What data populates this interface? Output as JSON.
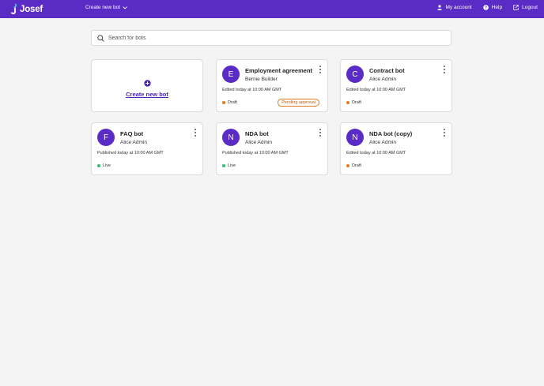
{
  "header": {
    "brand": "Josef",
    "create_menu_label": "Create new bot",
    "nav": {
      "account": "My account",
      "help": "Help",
      "logout": "Logout"
    }
  },
  "search": {
    "placeholder": "Search for bots",
    "value": ""
  },
  "new_bot_card": {
    "label": "Create new bot"
  },
  "bots": [
    {
      "initial": "E",
      "name": "Employment agreement",
      "owner": "Bernie Builder",
      "meta": "Edited today at 10:00 AM GMT",
      "status": "Draft",
      "badge": "Pending approval"
    },
    {
      "initial": "C",
      "name": "Contract bot",
      "owner": "Alice Admin",
      "meta": "Edited today at 10:00 AM GMT",
      "status": "Draft"
    },
    {
      "initial": "F",
      "name": "FAQ bot",
      "owner": "Alice Admin",
      "meta": "Published today at 10:00 AM GMT",
      "status": "Live"
    },
    {
      "initial": "N",
      "name": "NDA bot",
      "owner": "Alice Admin",
      "meta": "Published today at 10:00 AM GMT",
      "status": "Live"
    },
    {
      "initial": "N",
      "name": "NDA bot (copy)",
      "owner": "Alice Admin",
      "meta": "Edited today at 10:00 AM GMT",
      "status": "Draft"
    }
  ],
  "colors": {
    "brand": "#5b2bc5",
    "draft": "#e07b1f",
    "live": "#2fbf71"
  },
  "icons": {
    "account": "user-icon",
    "help": "help-circle-icon",
    "logout": "logout-icon",
    "search": "search-icon",
    "create": "plus-circle-icon",
    "menu": "kebab-menu-icon"
  }
}
